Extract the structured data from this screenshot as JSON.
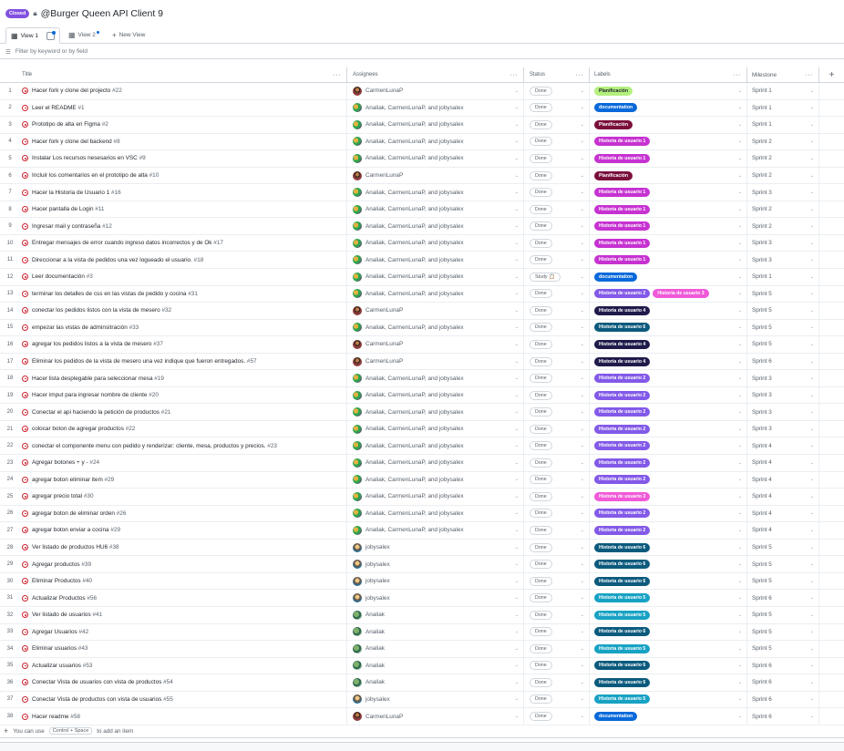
{
  "header": {
    "closed_badge": "Closed",
    "title": "@Burger Queen API Client 9"
  },
  "tabs": [
    {
      "label": "View 1"
    },
    {
      "label": "View 2"
    },
    {
      "label": "New View"
    }
  ],
  "filter": {
    "placeholder": "Filter by keyword or by field"
  },
  "columns": {
    "title": "Title",
    "assignees": "Assignees",
    "status": "Status",
    "labels": "Labels",
    "milestone": "Milestone"
  },
  "colors": {
    "Planificación_light": "#b4f07f",
    "Planificación_dark": "#7a0f3b",
    "documentation": "#0969da",
    "Historia de usuario 1": "#c632d1",
    "Historia de usuario 2": "#8259e8",
    "Historia de usuario 3": "#f059d8",
    "Historia de usuario 4": "#1e1b4b",
    "Historia de usuario 5": "#17a2c4",
    "Historia de usuario 6": "#0b5a7d"
  },
  "rows": [
    {
      "n": "1",
      "title": "Hacer fork y clone del projecto",
      "num": "#22",
      "asg": "CarmenLunaP",
      "av": "carmen",
      "status": "Done",
      "labels": [
        {
          "t": "Planificación",
          "bg": "#b4f07f",
          "fg": "#1f2328"
        }
      ],
      "ms": "Sprint 1"
    },
    {
      "n": "2",
      "title": "Leer el README",
      "num": "#1",
      "asg": "Analiak, CarmenLunaP, and jobysalex",
      "av": "multi",
      "status": "Done",
      "labels": [
        {
          "t": "documentation",
          "bg": "#0969da",
          "fg": "#fff"
        }
      ],
      "ms": "Sprint 1"
    },
    {
      "n": "3",
      "title": "Prototipo de alta en Figma",
      "num": "#2",
      "asg": "Analiak, CarmenLunaP, and jobysalex",
      "av": "multi",
      "status": "Done",
      "labels": [
        {
          "t": "Planificación",
          "bg": "#7a0f3b",
          "fg": "#fff"
        }
      ],
      "ms": "Sprint 1"
    },
    {
      "n": "4",
      "title": "Hacer fork y clone del backend",
      "num": "#8",
      "asg": "Analiak, CarmenLunaP, and jobysalex",
      "av": "multi",
      "status": "Done",
      "labels": [
        {
          "t": "Historia de usuario 1",
          "bg": "#c632d1",
          "fg": "#fff"
        }
      ],
      "ms": "Sprint 2"
    },
    {
      "n": "5",
      "title": "Instalar Los recursos nesesarios en VSC",
      "num": "#9",
      "asg": "Analiak, CarmenLunaP, and jobysalex",
      "av": "multi",
      "status": "Done",
      "labels": [
        {
          "t": "Historia de usuario 1",
          "bg": "#c632d1",
          "fg": "#fff"
        }
      ],
      "ms": "Sprint 2"
    },
    {
      "n": "6",
      "title": "Incluir los comentarios en el prototipo de alta",
      "num": "#10",
      "asg": "CarmenLunaP",
      "av": "carmen",
      "status": "Done",
      "labels": [
        {
          "t": "Planificación",
          "bg": "#7a0f3b",
          "fg": "#fff"
        }
      ],
      "ms": "Sprint 2"
    },
    {
      "n": "7",
      "title": "Hacer la Historia de Usuario 1",
      "num": "#16",
      "asg": "Analiak, CarmenLunaP, and jobysalex",
      "av": "multi",
      "status": "Done",
      "labels": [
        {
          "t": "Historia de usuario 1",
          "bg": "#c632d1",
          "fg": "#fff"
        }
      ],
      "ms": "Sprint 3"
    },
    {
      "n": "8",
      "title": "Hacer pantalla de Login",
      "num": "#11",
      "asg": "Analiak, CarmenLunaP, and jobysalex",
      "av": "multi",
      "status": "Done",
      "labels": [
        {
          "t": "Historia de usuario 1",
          "bg": "#c632d1",
          "fg": "#fff"
        }
      ],
      "ms": "Sprint 2"
    },
    {
      "n": "9",
      "title": "Ingresar mail y contraseña",
      "num": "#12",
      "asg": "Analiak, CarmenLunaP, and jobysalex",
      "av": "multi",
      "status": "Done",
      "labels": [
        {
          "t": "Historia de usuario 1",
          "bg": "#c632d1",
          "fg": "#fff"
        }
      ],
      "ms": "Sprint 2"
    },
    {
      "n": "10",
      "title": "Entregar mensajes de error cuando ingreso datos incorrectos y de Ok",
      "num": "#17",
      "asg": "Analiak, CarmenLunaP, and jobysalex",
      "av": "multi",
      "status": "Done",
      "labels": [
        {
          "t": "Historia de usuario 1",
          "bg": "#c632d1",
          "fg": "#fff"
        }
      ],
      "ms": "Sprint 3"
    },
    {
      "n": "11",
      "title": "Direccionar a la vista de pedidos una vez logueado el usuario.",
      "num": "#18",
      "asg": "Analiak, CarmenLunaP, and jobysalex",
      "av": "multi",
      "status": "Done",
      "labels": [
        {
          "t": "Historia de usuario 1",
          "bg": "#c632d1",
          "fg": "#fff"
        }
      ],
      "ms": "Sprint 3"
    },
    {
      "n": "12",
      "title": "Leer documentación",
      "num": "#3",
      "asg": "Analiak, CarmenLunaP, and jobysalex",
      "av": "multi",
      "status": "Study 📋",
      "labels": [
        {
          "t": "documentation",
          "bg": "#0969da",
          "fg": "#fff"
        }
      ],
      "ms": "Sprint 1"
    },
    {
      "n": "13",
      "title": "terminar los detalles de css en las vistas de pedido y cocina",
      "num": "#31",
      "asg": "Analiak, CarmenLunaP, and jobysalex",
      "av": "multi",
      "status": "Done",
      "labels": [
        {
          "t": "Historia de usuario 2",
          "bg": "#8259e8",
          "fg": "#fff"
        },
        {
          "t": "Historia de usuario 3",
          "bg": "#f059d8",
          "fg": "#fff"
        }
      ],
      "ms": "Sprint 5"
    },
    {
      "n": "14",
      "title": "conectar los pedidos listos con la vista de mesero",
      "num": "#32",
      "asg": "CarmenLunaP",
      "av": "carmen",
      "status": "Done",
      "labels": [
        {
          "t": "Historia de usuario 4",
          "bg": "#1e1b4b",
          "fg": "#fff"
        }
      ],
      "ms": "Sprint 5"
    },
    {
      "n": "15",
      "title": "empezar las vistas de adminsitración",
      "num": "#33",
      "asg": "Analiak, CarmenLunaP, and jobysalex",
      "av": "multi",
      "status": "Done",
      "labels": [
        {
          "t": "Historia de usuario 6",
          "bg": "#0b5a7d",
          "fg": "#fff"
        }
      ],
      "ms": "Sprint 5"
    },
    {
      "n": "16",
      "title": "agregar los pedidos listos a la vista de mesero",
      "num": "#37",
      "asg": "CarmenLunaP",
      "av": "carmen",
      "status": "Done",
      "labels": [
        {
          "t": "Historia de usuario 4",
          "bg": "#1e1b4b",
          "fg": "#fff"
        }
      ],
      "ms": "Sprint 5"
    },
    {
      "n": "17",
      "title": "Eliminar los pedidos de la vista de mesero una vez indique que fueron entregados.",
      "num": "#57",
      "asg": "CarmenLunaP",
      "av": "carmen",
      "status": "Done",
      "labels": [
        {
          "t": "Historia de usuario 4",
          "bg": "#1e1b4b",
          "fg": "#fff"
        }
      ],
      "ms": "Sprint 6"
    },
    {
      "n": "18",
      "title": "Hacer lista desplegable para seleccionar mesa",
      "num": "#19",
      "asg": "Analiak, CarmenLunaP, and jobysalex",
      "av": "multi",
      "status": "Done",
      "labels": [
        {
          "t": "Historia de usuario 2",
          "bg": "#8259e8",
          "fg": "#fff"
        }
      ],
      "ms": "Sprint 3"
    },
    {
      "n": "19",
      "title": "Hacer imput para ingresar nombre de cliente",
      "num": "#20",
      "asg": "Analiak, CarmenLunaP, and jobysalex",
      "av": "multi",
      "status": "Done",
      "labels": [
        {
          "t": "Historia de usuario 2",
          "bg": "#8259e8",
          "fg": "#fff"
        }
      ],
      "ms": "Sprint 3"
    },
    {
      "n": "20",
      "title": "Conectar el api haciendo la petición de productos",
      "num": "#21",
      "asg": "Analiak, CarmenLunaP, and jobysalex",
      "av": "multi",
      "status": "Done",
      "labels": [
        {
          "t": "Historia de usuario 2",
          "bg": "#8259e8",
          "fg": "#fff"
        }
      ],
      "ms": "Sprint 3"
    },
    {
      "n": "21",
      "title": "colocar boton de agregar productos",
      "num": "#22",
      "asg": "Analiak, CarmenLunaP, and jobysalex",
      "av": "multi",
      "status": "Done",
      "labels": [
        {
          "t": "Historia de usuario 2",
          "bg": "#8259e8",
          "fg": "#fff"
        }
      ],
      "ms": "Sprint 3"
    },
    {
      "n": "22",
      "title": "conectar el componente menu con pedido y renderizar: cliente, mesa, productos y precios.",
      "num": "#23",
      "asg": "Analiak, CarmenLunaP, and jobysalex",
      "av": "multi",
      "status": "Done",
      "labels": [
        {
          "t": "Historia de usuario 2",
          "bg": "#8259e8",
          "fg": "#fff"
        }
      ],
      "ms": "Sprint 4"
    },
    {
      "n": "23",
      "title": "Agregar botones + y -",
      "num": "#24",
      "asg": "Analiak, CarmenLunaP, and jobysalex",
      "av": "multi",
      "status": "Done",
      "labels": [
        {
          "t": "Historia de usuario 2",
          "bg": "#8259e8",
          "fg": "#fff"
        }
      ],
      "ms": "Sprint 4"
    },
    {
      "n": "24",
      "title": "agregar boton eliminar item",
      "num": "#29",
      "asg": "Analiak, CarmenLunaP, and jobysalex",
      "av": "multi",
      "status": "Done",
      "labels": [
        {
          "t": "Historia de usuario 2",
          "bg": "#8259e8",
          "fg": "#fff"
        }
      ],
      "ms": "Sprint 4"
    },
    {
      "n": "25",
      "title": "agregar precio total",
      "num": "#30",
      "asg": "Analiak, CarmenLunaP, and jobysalex",
      "av": "multi",
      "status": "Done",
      "labels": [
        {
          "t": "Historia de usuario 3",
          "bg": "#f059d8",
          "fg": "#fff"
        }
      ],
      "ms": "Sprint 4"
    },
    {
      "n": "26",
      "title": "agregar boton de eliminar orden",
      "num": "#26",
      "asg": "Analiak, CarmenLunaP, and jobysalex",
      "av": "multi",
      "status": "Done",
      "labels": [
        {
          "t": "Historia de usuario 2",
          "bg": "#8259e8",
          "fg": "#fff"
        }
      ],
      "ms": "Sprint 4"
    },
    {
      "n": "27",
      "title": "agregar boton enviar a cocina",
      "num": "#29",
      "asg": "Analiak, CarmenLunaP, and jobysalex",
      "av": "multi",
      "status": "Done",
      "labels": [
        {
          "t": "Historia de usuario 2",
          "bg": "#8259e8",
          "fg": "#fff"
        }
      ],
      "ms": "Sprint 4"
    },
    {
      "n": "28",
      "title": "Ver listado de productos HU6",
      "num": "#38",
      "asg": "jobysalex",
      "av": "joby",
      "status": "Done",
      "labels": [
        {
          "t": "Historia de usuario 6",
          "bg": "#0b5a7d",
          "fg": "#fff"
        }
      ],
      "ms": "Sprint 5"
    },
    {
      "n": "29",
      "title": "Agregar productos",
      "num": "#39",
      "asg": "jobysalex",
      "av": "joby",
      "status": "Done",
      "labels": [
        {
          "t": "Historia de usuario 6",
          "bg": "#0b5a7d",
          "fg": "#fff"
        }
      ],
      "ms": "Sprint 5"
    },
    {
      "n": "30",
      "title": "Eliminar Productos",
      "num": "#40",
      "asg": "jobysalex",
      "av": "joby",
      "status": "Done",
      "labels": [
        {
          "t": "Historia de usuario 6",
          "bg": "#0b5a7d",
          "fg": "#fff"
        }
      ],
      "ms": "Sprint 5"
    },
    {
      "n": "31",
      "title": "Actualizar Productos",
      "num": "#56",
      "asg": "jobysalex",
      "av": "joby",
      "status": "Done",
      "labels": [
        {
          "t": "Historia de usuario 5",
          "bg": "#17a2c4",
          "fg": "#fff"
        }
      ],
      "ms": "Sprint 6"
    },
    {
      "n": "32",
      "title": "Ver listado de usuarios",
      "num": "#41",
      "asg": "Analiak",
      "av": "ana",
      "status": "Done",
      "labels": [
        {
          "t": "Historia de usuario 5",
          "bg": "#17a2c4",
          "fg": "#fff"
        }
      ],
      "ms": "Sprint 5"
    },
    {
      "n": "33",
      "title": "Agregar Usuarios",
      "num": "#42",
      "asg": "Analiak",
      "av": "ana",
      "status": "Done",
      "labels": [
        {
          "t": "Historia de usuario 6",
          "bg": "#0b5a7d",
          "fg": "#fff"
        }
      ],
      "ms": "Sprint 5"
    },
    {
      "n": "34",
      "title": "Eliminar usuarios",
      "num": "#43",
      "asg": "Analiak",
      "av": "ana",
      "status": "Done",
      "labels": [
        {
          "t": "Historia de usuario 5",
          "bg": "#17a2c4",
          "fg": "#fff"
        }
      ],
      "ms": "Sprint 5"
    },
    {
      "n": "35",
      "title": "Actualizar usuarios",
      "num": "#53",
      "asg": "Analiak",
      "av": "ana",
      "status": "Done",
      "labels": [
        {
          "t": "Historia de usuario 6",
          "bg": "#0b5a7d",
          "fg": "#fff"
        }
      ],
      "ms": "Sprint 6"
    },
    {
      "n": "36",
      "title": "Conectar Vista de usuarios con vista de productos",
      "num": "#54",
      "asg": "Analiak",
      "av": "ana",
      "status": "Done",
      "labels": [
        {
          "t": "Historia de usuario 6",
          "bg": "#0b5a7d",
          "fg": "#fff"
        }
      ],
      "ms": "Sprint 6"
    },
    {
      "n": "37",
      "title": "Conectar Vista de productos con vista de usuarios",
      "num": "#55",
      "asg": "jobysalex",
      "av": "joby",
      "status": "Done",
      "labels": [
        {
          "t": "Historia de usuario 5",
          "bg": "#17a2c4",
          "fg": "#fff"
        }
      ],
      "ms": "Sprint 6"
    },
    {
      "n": "38",
      "title": "Hacer readme",
      "num": "#58",
      "asg": "CarmenLunaP",
      "av": "carmen",
      "status": "Done",
      "labels": [
        {
          "t": "documentation",
          "bg": "#0969da",
          "fg": "#fff"
        }
      ],
      "ms": "Sprint 6"
    }
  ],
  "footer": {
    "prefix": "You can use",
    "shortcut": "Control + Space",
    "suffix": "to add an item"
  }
}
